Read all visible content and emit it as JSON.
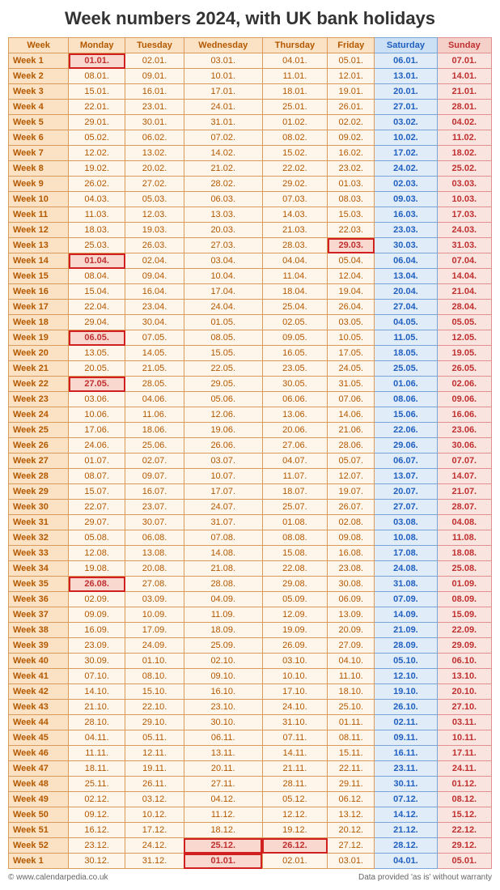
{
  "title": "Week numbers 2024, with UK bank holidays",
  "headers": [
    "Week",
    "Monday",
    "Tuesday",
    "Wednesday",
    "Thursday",
    "Friday",
    "Saturday",
    "Sunday"
  ],
  "footer": {
    "left": "© www.calendarpedia.co.uk",
    "right": "Data provided 'as is' without warranty"
  },
  "holidays": [
    "01.01.",
    "29.03.",
    "01.04.",
    "06.05.",
    "27.05.",
    "26.08.",
    "25.12.",
    "26.12.",
    "01.01.b"
  ],
  "weeks": [
    {
      "num": "Week 1",
      "days": [
        "01.01.",
        "02.01.",
        "03.01.",
        "04.01.",
        "05.01.",
        "06.01.",
        "07.01."
      ]
    },
    {
      "num": "Week 2",
      "days": [
        "08.01.",
        "09.01.",
        "10.01.",
        "11.01.",
        "12.01.",
        "13.01.",
        "14.01."
      ]
    },
    {
      "num": "Week 3",
      "days": [
        "15.01.",
        "16.01.",
        "17.01.",
        "18.01.",
        "19.01.",
        "20.01.",
        "21.01."
      ]
    },
    {
      "num": "Week 4",
      "days": [
        "22.01.",
        "23.01.",
        "24.01.",
        "25.01.",
        "26.01.",
        "27.01.",
        "28.01."
      ]
    },
    {
      "num": "Week 5",
      "days": [
        "29.01.",
        "30.01.",
        "31.01.",
        "01.02.",
        "02.02.",
        "03.02.",
        "04.02."
      ]
    },
    {
      "num": "Week 6",
      "days": [
        "05.02.",
        "06.02.",
        "07.02.",
        "08.02.",
        "09.02.",
        "10.02.",
        "11.02."
      ]
    },
    {
      "num": "Week 7",
      "days": [
        "12.02.",
        "13.02.",
        "14.02.",
        "15.02.",
        "16.02.",
        "17.02.",
        "18.02."
      ]
    },
    {
      "num": "Week 8",
      "days": [
        "19.02.",
        "20.02.",
        "21.02.",
        "22.02.",
        "23.02.",
        "24.02.",
        "25.02."
      ]
    },
    {
      "num": "Week 9",
      "days": [
        "26.02.",
        "27.02.",
        "28.02.",
        "29.02.",
        "01.03.",
        "02.03.",
        "03.03."
      ]
    },
    {
      "num": "Week 10",
      "days": [
        "04.03.",
        "05.03.",
        "06.03.",
        "07.03.",
        "08.03.",
        "09.03.",
        "10.03."
      ]
    },
    {
      "num": "Week 11",
      "days": [
        "11.03.",
        "12.03.",
        "13.03.",
        "14.03.",
        "15.03.",
        "16.03.",
        "17.03."
      ]
    },
    {
      "num": "Week 12",
      "days": [
        "18.03.",
        "19.03.",
        "20.03.",
        "21.03.",
        "22.03.",
        "23.03.",
        "24.03."
      ]
    },
    {
      "num": "Week 13",
      "days": [
        "25.03.",
        "26.03.",
        "27.03.",
        "28.03.",
        "29.03.",
        "30.03.",
        "31.03."
      ]
    },
    {
      "num": "Week 14",
      "days": [
        "01.04.",
        "02.04.",
        "03.04.",
        "04.04.",
        "05.04.",
        "06.04.",
        "07.04."
      ]
    },
    {
      "num": "Week 15",
      "days": [
        "08.04.",
        "09.04.",
        "10.04.",
        "11.04.",
        "12.04.",
        "13.04.",
        "14.04."
      ]
    },
    {
      "num": "Week 16",
      "days": [
        "15.04.",
        "16.04.",
        "17.04.",
        "18.04.",
        "19.04.",
        "20.04.",
        "21.04."
      ]
    },
    {
      "num": "Week 17",
      "days": [
        "22.04.",
        "23.04.",
        "24.04.",
        "25.04.",
        "26.04.",
        "27.04.",
        "28.04."
      ]
    },
    {
      "num": "Week 18",
      "days": [
        "29.04.",
        "30.04.",
        "01.05.",
        "02.05.",
        "03.05.",
        "04.05.",
        "05.05."
      ]
    },
    {
      "num": "Week 19",
      "days": [
        "06.05.",
        "07.05.",
        "08.05.",
        "09.05.",
        "10.05.",
        "11.05.",
        "12.05."
      ]
    },
    {
      "num": "Week 20",
      "days": [
        "13.05.",
        "14.05.",
        "15.05.",
        "16.05.",
        "17.05.",
        "18.05.",
        "19.05."
      ]
    },
    {
      "num": "Week 21",
      "days": [
        "20.05.",
        "21.05.",
        "22.05.",
        "23.05.",
        "24.05.",
        "25.05.",
        "26.05."
      ]
    },
    {
      "num": "Week 22",
      "days": [
        "27.05.",
        "28.05.",
        "29.05.",
        "30.05.",
        "31.05.",
        "01.06.",
        "02.06."
      ]
    },
    {
      "num": "Week 23",
      "days": [
        "03.06.",
        "04.06.",
        "05.06.",
        "06.06.",
        "07.06.",
        "08.06.",
        "09.06."
      ]
    },
    {
      "num": "Week 24",
      "days": [
        "10.06.",
        "11.06.",
        "12.06.",
        "13.06.",
        "14.06.",
        "15.06.",
        "16.06."
      ]
    },
    {
      "num": "Week 25",
      "days": [
        "17.06.",
        "18.06.",
        "19.06.",
        "20.06.",
        "21.06.",
        "22.06.",
        "23.06."
      ]
    },
    {
      "num": "Week 26",
      "days": [
        "24.06.",
        "25.06.",
        "26.06.",
        "27.06.",
        "28.06.",
        "29.06.",
        "30.06."
      ]
    },
    {
      "num": "Week 27",
      "days": [
        "01.07.",
        "02.07.",
        "03.07.",
        "04.07.",
        "05.07.",
        "06.07.",
        "07.07."
      ]
    },
    {
      "num": "Week 28",
      "days": [
        "08.07.",
        "09.07.",
        "10.07.",
        "11.07.",
        "12.07.",
        "13.07.",
        "14.07."
      ]
    },
    {
      "num": "Week 29",
      "days": [
        "15.07.",
        "16.07.",
        "17.07.",
        "18.07.",
        "19.07.",
        "20.07.",
        "21.07."
      ]
    },
    {
      "num": "Week 30",
      "days": [
        "22.07.",
        "23.07.",
        "24.07.",
        "25.07.",
        "26.07.",
        "27.07.",
        "28.07."
      ]
    },
    {
      "num": "Week 31",
      "days": [
        "29.07.",
        "30.07.",
        "31.07.",
        "01.08.",
        "02.08.",
        "03.08.",
        "04.08."
      ]
    },
    {
      "num": "Week 32",
      "days": [
        "05.08.",
        "06.08.",
        "07.08.",
        "08.08.",
        "09.08.",
        "10.08.",
        "11.08."
      ]
    },
    {
      "num": "Week 33",
      "days": [
        "12.08.",
        "13.08.",
        "14.08.",
        "15.08.",
        "16.08.",
        "17.08.",
        "18.08."
      ]
    },
    {
      "num": "Week 34",
      "days": [
        "19.08.",
        "20.08.",
        "21.08.",
        "22.08.",
        "23.08.",
        "24.08.",
        "25.08."
      ]
    },
    {
      "num": "Week 35",
      "days": [
        "26.08.",
        "27.08.",
        "28.08.",
        "29.08.",
        "30.08.",
        "31.08.",
        "01.09."
      ]
    },
    {
      "num": "Week 36",
      "days": [
        "02.09.",
        "03.09.",
        "04.09.",
        "05.09.",
        "06.09.",
        "07.09.",
        "08.09."
      ]
    },
    {
      "num": "Week 37",
      "days": [
        "09.09.",
        "10.09.",
        "11.09.",
        "12.09.",
        "13.09.",
        "14.09.",
        "15.09."
      ]
    },
    {
      "num": "Week 38",
      "days": [
        "16.09.",
        "17.09.",
        "18.09.",
        "19.09.",
        "20.09.",
        "21.09.",
        "22.09."
      ]
    },
    {
      "num": "Week 39",
      "days": [
        "23.09.",
        "24.09.",
        "25.09.",
        "26.09.",
        "27.09.",
        "28.09.",
        "29.09."
      ]
    },
    {
      "num": "Week 40",
      "days": [
        "30.09.",
        "01.10.",
        "02.10.",
        "03.10.",
        "04.10.",
        "05.10.",
        "06.10."
      ]
    },
    {
      "num": "Week 41",
      "days": [
        "07.10.",
        "08.10.",
        "09.10.",
        "10.10.",
        "11.10.",
        "12.10.",
        "13.10."
      ]
    },
    {
      "num": "Week 42",
      "days": [
        "14.10.",
        "15.10.",
        "16.10.",
        "17.10.",
        "18.10.",
        "19.10.",
        "20.10."
      ]
    },
    {
      "num": "Week 43",
      "days": [
        "21.10.",
        "22.10.",
        "23.10.",
        "24.10.",
        "25.10.",
        "26.10.",
        "27.10."
      ]
    },
    {
      "num": "Week 44",
      "days": [
        "28.10.",
        "29.10.",
        "30.10.",
        "31.10.",
        "01.11.",
        "02.11.",
        "03.11."
      ]
    },
    {
      "num": "Week 45",
      "days": [
        "04.11.",
        "05.11.",
        "06.11.",
        "07.11.",
        "08.11.",
        "09.11.",
        "10.11."
      ]
    },
    {
      "num": "Week 46",
      "days": [
        "11.11.",
        "12.11.",
        "13.11.",
        "14.11.",
        "15.11.",
        "16.11.",
        "17.11."
      ]
    },
    {
      "num": "Week 47",
      "days": [
        "18.11.",
        "19.11.",
        "20.11.",
        "21.11.",
        "22.11.",
        "23.11.",
        "24.11."
      ]
    },
    {
      "num": "Week 48",
      "days": [
        "25.11.",
        "26.11.",
        "27.11.",
        "28.11.",
        "29.11.",
        "30.11.",
        "01.12."
      ]
    },
    {
      "num": "Week 49",
      "days": [
        "02.12.",
        "03.12.",
        "04.12.",
        "05.12.",
        "06.12.",
        "07.12.",
        "08.12."
      ]
    },
    {
      "num": "Week 50",
      "days": [
        "09.12.",
        "10.12.",
        "11.12.",
        "12.12.",
        "13.12.",
        "14.12.",
        "15.12."
      ]
    },
    {
      "num": "Week 51",
      "days": [
        "16.12.",
        "17.12.",
        "18.12.",
        "19.12.",
        "20.12.",
        "21.12.",
        "22.12."
      ]
    },
    {
      "num": "Week 52",
      "days": [
        "23.12.",
        "24.12.",
        "25.12.",
        "26.12.",
        "27.12.",
        "28.12.",
        "29.12."
      ]
    },
    {
      "num": "Week 1",
      "days": [
        "30.12.",
        "31.12.",
        "01.01.",
        "02.01.",
        "03.01.",
        "04.01.",
        "05.01."
      ],
      "lastRow": true
    }
  ]
}
